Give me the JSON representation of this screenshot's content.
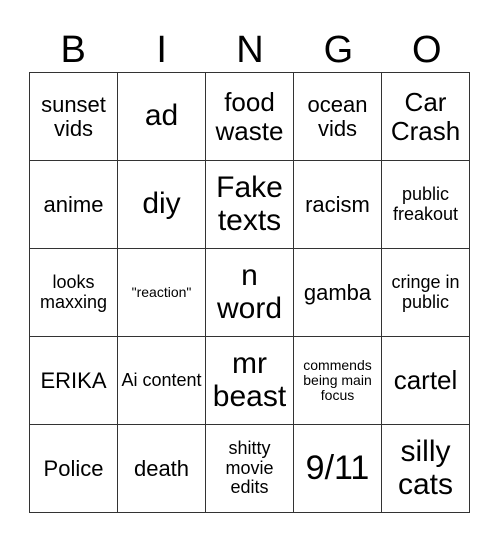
{
  "header": [
    "B",
    "I",
    "N",
    "G",
    "O"
  ],
  "board": [
    [
      "sunset vids",
      "ad",
      "food waste",
      "ocean vids",
      "Car Crash"
    ],
    [
      "anime",
      "diy",
      "Fake texts",
      "racism",
      "public freakout"
    ],
    [
      "looks maxxing",
      "\"reaction\"",
      "n word",
      "gamba",
      "cringe in public"
    ],
    [
      "ERIKA",
      "Ai content",
      "mr beast",
      "commends being main focus",
      "cartel"
    ],
    [
      "Police",
      "death",
      "shitty movie edits",
      "9/11",
      "silly cats"
    ]
  ]
}
